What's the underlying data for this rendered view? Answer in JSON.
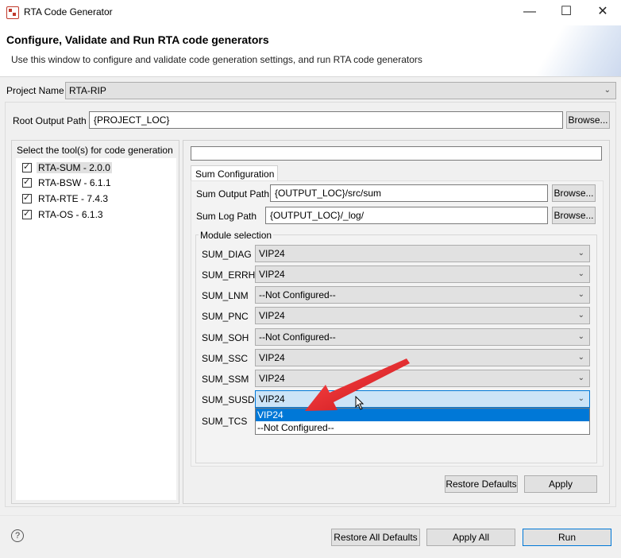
{
  "window": {
    "title": "RTA Code Generator",
    "minimize_glyph": "—",
    "maximize_glyph": "☐",
    "close_glyph": "✕"
  },
  "header": {
    "heading": "Configure, Validate and Run RTA code generators",
    "description": "Use this window to configure and validate code generation settings, and run RTA code generators"
  },
  "project": {
    "label": "Project Name",
    "value": "RTA-RIP"
  },
  "root_output": {
    "label": "Root Output Path",
    "value": "{PROJECT_LOC}",
    "browse": "Browse..."
  },
  "tools": {
    "title": "Select the tool(s) for code generation",
    "items": [
      {
        "label": "RTA-SUM - 2.0.0",
        "checked": true
      },
      {
        "label": "RTA-BSW - 6.1.1",
        "checked": true
      },
      {
        "label": "RTA-RTE - 7.4.3",
        "checked": true
      },
      {
        "label": "RTA-OS - 6.1.3",
        "checked": true
      }
    ]
  },
  "sum_config": {
    "tab": "Sum Configuration",
    "output_path": {
      "label": "Sum Output Path",
      "value": "{OUTPUT_LOC}/src/sum",
      "browse": "Browse..."
    },
    "log_path": {
      "label": "Sum Log Path",
      "value": "{OUTPUT_LOC}/_log/",
      "browse": "Browse..."
    },
    "module_group": "Module selection",
    "modules": [
      {
        "label": "SUM_DIAG",
        "value": "VIP24"
      },
      {
        "label": "SUM_ERRH",
        "value": "VIP24"
      },
      {
        "label": "SUM_LNM",
        "value": "--Not Configured--"
      },
      {
        "label": "SUM_PNC",
        "value": "VIP24"
      },
      {
        "label": "SUM_SOH",
        "value": "--Not Configured--"
      },
      {
        "label": "SUM_SSC",
        "value": "VIP24"
      },
      {
        "label": "SUM_SSM",
        "value": "VIP24"
      },
      {
        "label": "SUM_SUSD",
        "value": "VIP24"
      },
      {
        "label": "SUM_TCS",
        "value": ""
      }
    ],
    "dropdown_options": [
      "VIP24",
      "--Not Configured--"
    ],
    "restore_defaults": "Restore Defaults",
    "apply": "Apply"
  },
  "footer": {
    "help_glyph": "?",
    "restore_all": "Restore All Defaults",
    "apply_all": "Apply All",
    "run": "Run"
  },
  "colors": {
    "accent": "#0078d7",
    "arrow": "#e8262b"
  }
}
